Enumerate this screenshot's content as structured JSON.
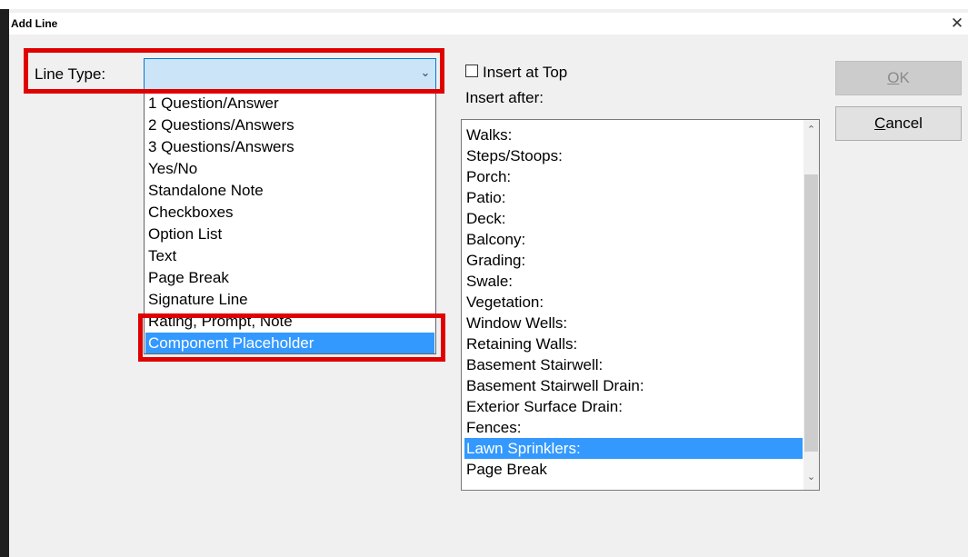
{
  "dialog": {
    "title": "Add Line"
  },
  "line_type": {
    "label": "Line Type:",
    "value": "",
    "options": [
      {
        "label": "1 Question/Answer",
        "selected": false
      },
      {
        "label": "2 Questions/Answers",
        "selected": false
      },
      {
        "label": "3 Questions/Answers",
        "selected": false
      },
      {
        "label": "Yes/No",
        "selected": false
      },
      {
        "label": "Standalone Note",
        "selected": false
      },
      {
        "label": "Checkboxes",
        "selected": false
      },
      {
        "label": "Option List",
        "selected": false
      },
      {
        "label": "Text",
        "selected": false
      },
      {
        "label": "Page Break",
        "selected": false
      },
      {
        "label": "Signature Line",
        "selected": false
      },
      {
        "label": "Rating, Prompt, Note",
        "selected": false
      },
      {
        "label": "Component Placeholder",
        "selected": true
      }
    ]
  },
  "insert_at_top": {
    "label": "Insert at Top",
    "checked": false
  },
  "insert_after": {
    "label": "Insert after:",
    "items": [
      {
        "label": "Walks:",
        "selected": false
      },
      {
        "label": "Steps/Stoops:",
        "selected": false
      },
      {
        "label": "Porch:",
        "selected": false
      },
      {
        "label": "Patio:",
        "selected": false
      },
      {
        "label": "Deck:",
        "selected": false
      },
      {
        "label": "Balcony:",
        "selected": false
      },
      {
        "label": "Grading:",
        "selected": false
      },
      {
        "label": "Swale:",
        "selected": false
      },
      {
        "label": "Vegetation:",
        "selected": false
      },
      {
        "label": "Window Wells:",
        "selected": false
      },
      {
        "label": "Retaining Walls:",
        "selected": false
      },
      {
        "label": "Basement Stairwell:",
        "selected": false
      },
      {
        "label": "Basement Stairwell Drain:",
        "selected": false
      },
      {
        "label": "Exterior Surface Drain:",
        "selected": false
      },
      {
        "label": "Fences:",
        "selected": false
      },
      {
        "label": "Lawn Sprinklers:",
        "selected": true
      },
      {
        "label": "Page Break",
        "selected": false
      }
    ]
  },
  "buttons": {
    "ok": {
      "label": "OK",
      "mnemonic": "O",
      "rest": "K",
      "enabled": false
    },
    "cancel": {
      "label": "Cancel",
      "mnemonic": "C",
      "rest": "ancel",
      "enabled": true
    }
  },
  "icons": {
    "close": "close-icon",
    "dropdown": "chevron-down-icon",
    "scroll_up": "chevron-up-icon",
    "scroll_down": "chevron-down-icon"
  },
  "colors": {
    "selection": "#3399ff",
    "highlight_box": "#e00000",
    "combo_focus": "#cce4f7"
  }
}
